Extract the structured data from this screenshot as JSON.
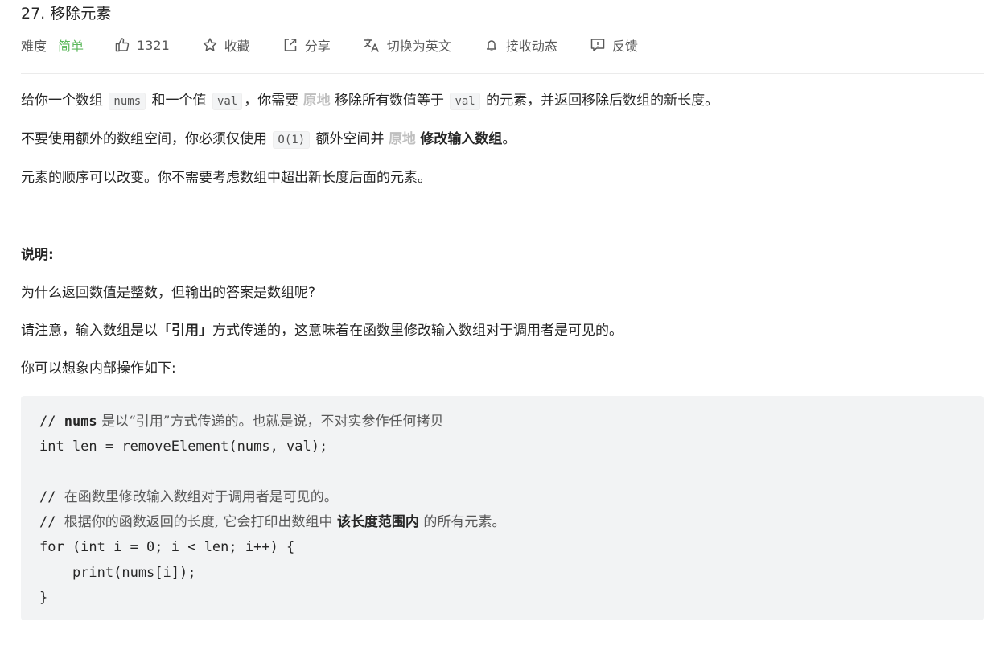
{
  "problem": {
    "title": "27. 移除元素"
  },
  "meta": {
    "difficulty_label": "难度",
    "difficulty_value": "简单",
    "likes": "1321",
    "favorite": "收藏",
    "share": "分享",
    "translate": "切换为英文",
    "subscribe": "接收动态",
    "feedback": "反馈",
    "colors": {
      "easy": "#5cb85c",
      "muted": "#595959"
    },
    "icons": [
      "thumbs-up-icon",
      "star-icon",
      "share-icon",
      "translate-icon",
      "bell-icon",
      "feedback-icon"
    ]
  },
  "description": {
    "p1": {
      "t1": "给你一个数组",
      "code1": "nums",
      "t2": "和一个值",
      "code2": "val",
      "t3": "，你需要",
      "hl": "原地",
      "t4": "移除所有数值等于",
      "code3": "val",
      "t5": "的元素，并返回移除后数组的新长度。"
    },
    "p2": {
      "t1": "不要使用额外的数组空间，你必须仅使用",
      "code1": "O(1)",
      "t2": "额外空间并",
      "hl": "原地",
      "bold": "修改输入数组",
      "t3": "。"
    },
    "p3": "元素的顺序可以改变。你不需要考虑数组中超出新长度后面的元素。"
  },
  "explanation": {
    "title": "说明:",
    "p1": "为什么返回数值是整数，但输出的答案是数组呢?",
    "p2": {
      "t1": "请注意，输入数组是以",
      "bold": "「引用」",
      "t2": "方式传递的，这意味着在函数里修改输入数组对于调用者是可见的。"
    },
    "p3": "你可以想象内部操作如下:"
  },
  "code": {
    "line1_prefix": "// ",
    "line1_bold": "nums",
    "line1_rest": " 是以“引用”方式传递的。也就是说，不对实参作任何拷贝",
    "line2": "int len = removeElement(nums, val);",
    "line3": "",
    "line4_prefix": "// ",
    "line4_rest": "在函数里修改输入数组对于调用者是可见的。",
    "line5_prefix": "// ",
    "line5_rest": "根据你的函数返回的长度, 它会打印出数组中 ",
    "line5_bold": "该长度范围内",
    "line5_tail": " 的所有元素。",
    "line6": "for (int i = 0; i < len; i++) {",
    "line7": "    print(nums[i]);",
    "line8": "}"
  }
}
